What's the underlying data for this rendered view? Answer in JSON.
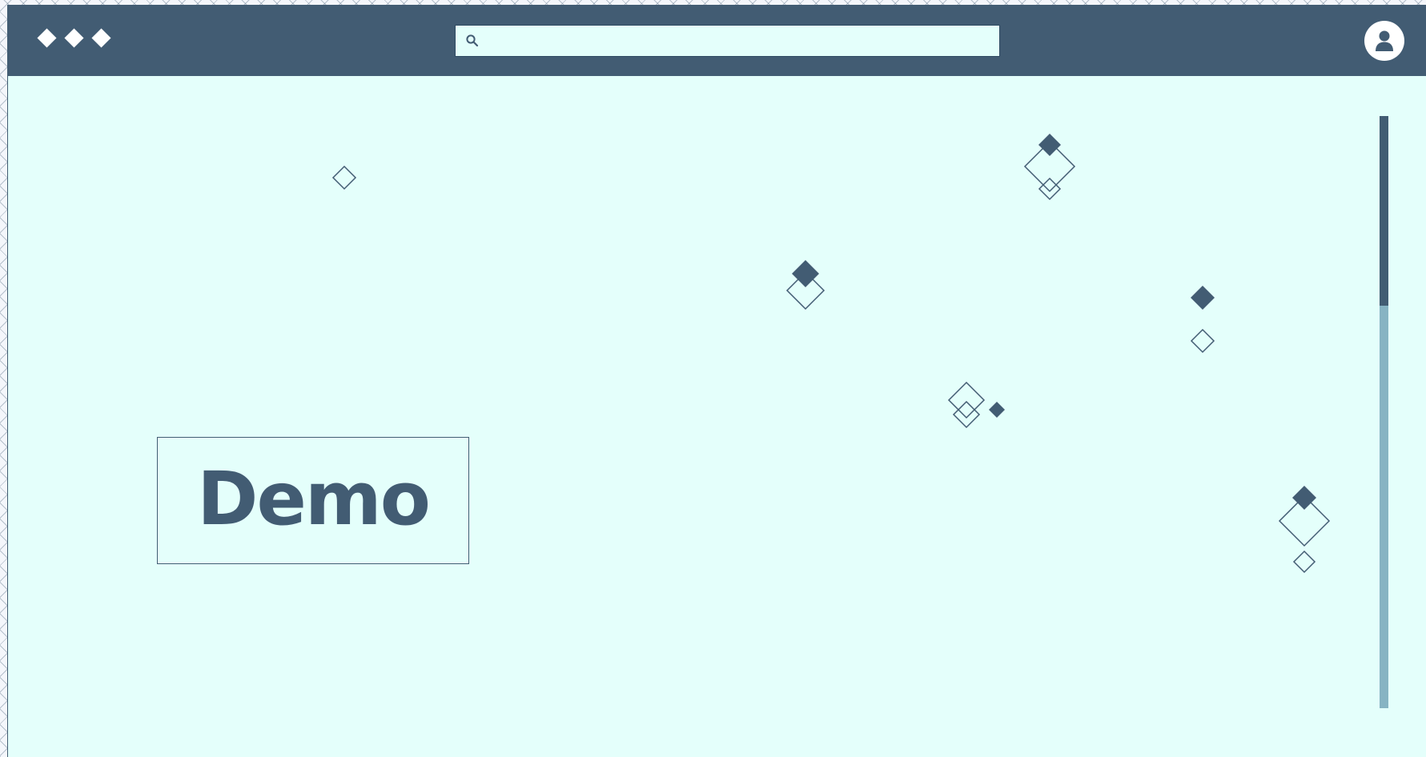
{
  "colors": {
    "primary": "#425c73",
    "background": "#e4fffb",
    "scroll_track": "#87b3c3",
    "white": "#ffffff"
  },
  "header": {
    "logo_icon": "three-diamonds-logo",
    "search": {
      "placeholder": "",
      "value": "",
      "icon": "search-icon"
    },
    "avatar_icon": "user-icon"
  },
  "main": {
    "title": "Demo"
  },
  "scrollbar": {
    "position_fraction": 0,
    "visible_fraction": 0.32
  }
}
